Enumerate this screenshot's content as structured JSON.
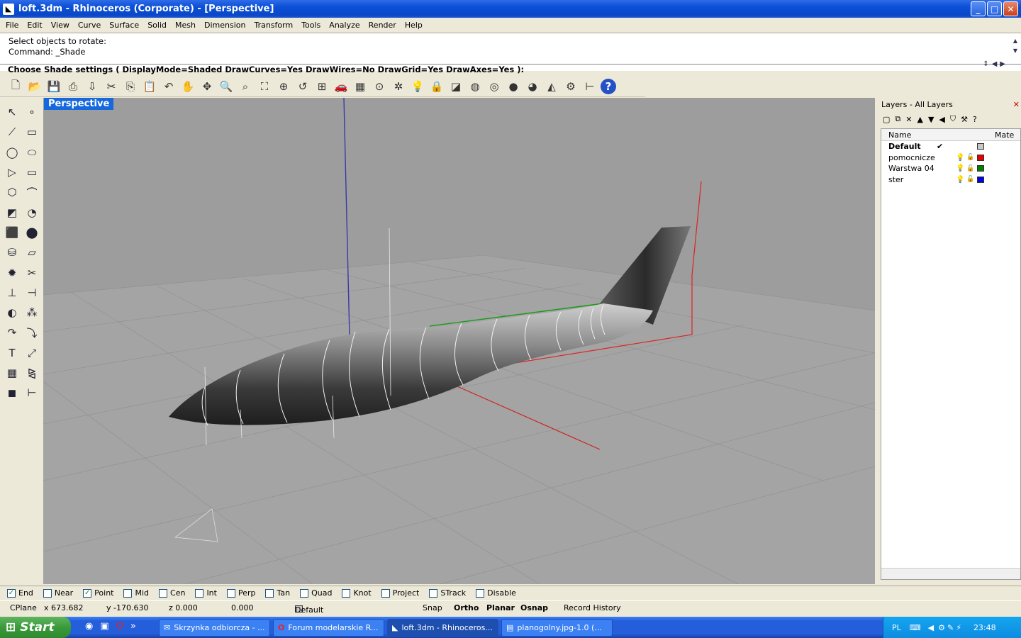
{
  "window": {
    "title": "loft.3dm - Rhinoceros (Corporate) - [Perspective]",
    "buttons": [
      "_",
      "□",
      "✕"
    ]
  },
  "menu": [
    "File",
    "Edit",
    "View",
    "Curve",
    "Surface",
    "Solid",
    "Mesh",
    "Dimension",
    "Transform",
    "Tools",
    "Analyze",
    "Render",
    "Help"
  ],
  "command": {
    "history1": "Select objects to rotate:",
    "history2": "Command: _Shade",
    "prompt": "Choose Shade settings ( DisplayMode=Shaded  DrawCurves=Yes  DrawWires=No  DrawGrid=Yes  DrawAxes=Yes ):"
  },
  "toolbar_icons": [
    "new-icon",
    "open-icon",
    "save-icon",
    "print-icon",
    "import-icon",
    "cut-icon",
    "copy-icon",
    "paste-icon",
    "undo-icon",
    "pan-icon",
    "rotate-view-icon",
    "zoom-icon",
    "zoom-window-icon",
    "zoom-extents-icon",
    "zoom-selected-icon",
    "undo-view-icon",
    "four-viewports-icon",
    "car-icon",
    "grid-icon",
    "point-icon",
    "light-icon",
    "bulb-icon",
    "lock-icon",
    "layers-icon",
    "color-wheel-icon",
    "wireframe-sphere-icon",
    "shaded-sphere-icon",
    "render-sphere-icon",
    "render-icon",
    "options-icon",
    "dimensions-icon",
    "help-icon"
  ],
  "viewport": {
    "label": "Perspective"
  },
  "layers": {
    "title": "Layers - All Layers",
    "col_name": "Name",
    "col_material": "Mate",
    "rows": [
      {
        "name": "Default",
        "current": "✔",
        "color": "#c8c8c8"
      },
      {
        "name": "pomocnicze",
        "current": "",
        "color": "#e60000"
      },
      {
        "name": "Warstwa 04",
        "current": "",
        "color": "#008000"
      },
      {
        "name": "ster",
        "current": "",
        "color": "#0000e0"
      }
    ]
  },
  "osnap": [
    {
      "label": "End",
      "checked": true
    },
    {
      "label": "Near",
      "checked": false
    },
    {
      "label": "Point",
      "checked": true
    },
    {
      "label": "Mid",
      "checked": false
    },
    {
      "label": "Cen",
      "checked": false
    },
    {
      "label": "Int",
      "checked": false
    },
    {
      "label": "Perp",
      "checked": false
    },
    {
      "label": "Tan",
      "checked": false
    },
    {
      "label": "Quad",
      "checked": false
    },
    {
      "label": "Knot",
      "checked": false
    },
    {
      "label": "Project",
      "checked": false
    },
    {
      "label": "STrack",
      "checked": false
    },
    {
      "label": "Disable",
      "checked": false
    }
  ],
  "status": {
    "cplane": "CPlane",
    "x": "x 673.682",
    "y": "y -170.630",
    "z": "z 0.000",
    "d": "0.000",
    "layer": "Default",
    "snap": "Snap",
    "ortho": "Ortho",
    "planar": "Planar",
    "osnap": "Osnap",
    "record": "Record History"
  },
  "taskbar": {
    "start": "Start",
    "tasks": [
      {
        "label": "Skrzynka odbiorcza - ..."
      },
      {
        "label": "Forum modelarskie R..."
      },
      {
        "label": "loft.3dm - Rhinoceros..."
      },
      {
        "label": "planogolny.jpg-1.0 (..."
      }
    ],
    "lang": "PL",
    "time": "23:48"
  }
}
